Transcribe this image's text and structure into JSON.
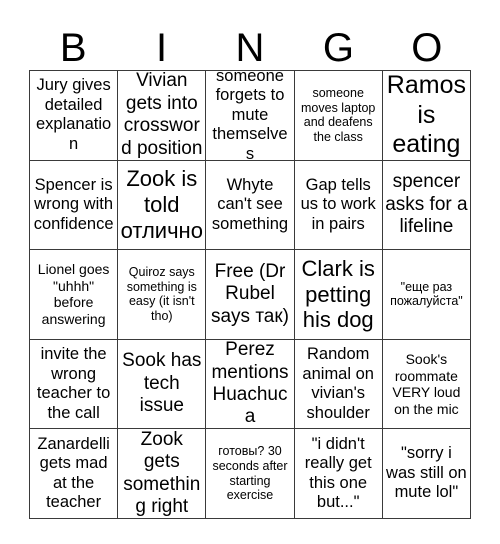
{
  "card": {
    "header_letters": [
      "B",
      "I",
      "N",
      "G",
      "O"
    ],
    "border_color": "#3a3a3a",
    "background_color": "#ffffff",
    "text_color": "#000000",
    "rows": 5,
    "columns": 5,
    "free_space_index": 12,
    "cells": [
      {
        "text": "Jury gives detailed explanation",
        "size": "fs-md"
      },
      {
        "text": "Vivian gets into crossword position",
        "size": "fs-lg"
      },
      {
        "text": "someone forgets to mute themselves",
        "size": "fs-md"
      },
      {
        "text": "someone moves laptop and deafens the class",
        "size": "fs-xs"
      },
      {
        "text": "Ramos is eating",
        "size": "fs-xxl"
      },
      {
        "text": "Spencer is wrong with confidence",
        "size": "fs-md"
      },
      {
        "text": "Zook is told отлично",
        "size": "fs-xl"
      },
      {
        "text": "Whyte can't see something",
        "size": "fs-md"
      },
      {
        "text": "Gap tells us to work in pairs",
        "size": "fs-md"
      },
      {
        "text": "spencer asks for a lifeline",
        "size": "fs-lg"
      },
      {
        "text": "Lionel goes \"uhhh\" before answering",
        "size": "fs-sm"
      },
      {
        "text": "Quiroz says something is easy (it isn't tho)",
        "size": "fs-xs"
      },
      {
        "text": "Free (Dr Rubel says так)",
        "size": "fs-lg"
      },
      {
        "text": "Clark is petting his dog",
        "size": "fs-xl"
      },
      {
        "text": "\"еще раз пожалуйста\"",
        "size": "fs-xs"
      },
      {
        "text": "invite the wrong teacher to the call",
        "size": "fs-md"
      },
      {
        "text": "Sook has tech issue",
        "size": "fs-lg"
      },
      {
        "text": "Perez mentions Huachuca",
        "size": "fs-lg"
      },
      {
        "text": "Random animal on vivian's shoulder",
        "size": "fs-md"
      },
      {
        "text": "Sook's roommate VERY loud on the mic",
        "size": "fs-sm"
      },
      {
        "text": "Zanardelli gets mad at the teacher",
        "size": "fs-md"
      },
      {
        "text": "Zook gets something right",
        "size": "fs-lg"
      },
      {
        "text": "готовы? 30 seconds after starting exercise",
        "size": "fs-xs"
      },
      {
        "text": "\"i didn't really get this one but...\"",
        "size": "fs-md"
      },
      {
        "text": "\"sorry i was still on mute lol\"",
        "size": "fs-md"
      }
    ]
  }
}
